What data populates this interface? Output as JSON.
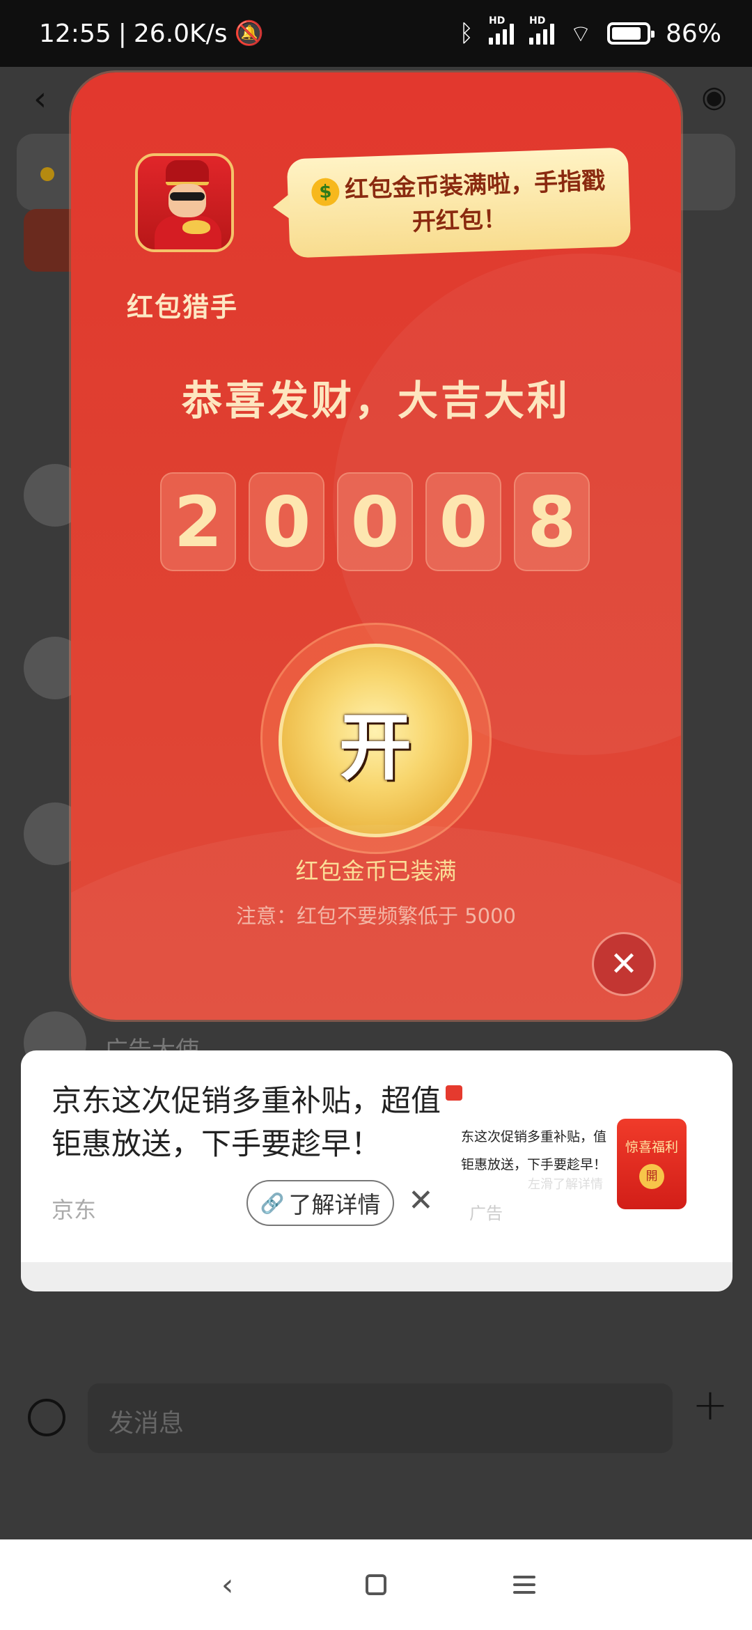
{
  "status": {
    "time": "12:55",
    "speed": "26.0K/s",
    "battery": "86%",
    "battery_level": 0.86,
    "icons": [
      "mute-bell-icon",
      "bluetooth-icon",
      "signal-icon",
      "wifi-icon",
      "battery-icon"
    ]
  },
  "background": {
    "partial_name": "广告大使",
    "input_placeholder": "发消息"
  },
  "modal": {
    "app_name": "红包猎手",
    "bubble_text": "红包金币装满啦，手指戳开红包！",
    "title": "恭喜发财，大吉大利",
    "digits": [
      "2",
      "0",
      "0",
      "0",
      "8"
    ],
    "open_label": "开",
    "coins_full_text": "红包金币已装满",
    "note_text": "注意：红包不要频繁低于 5000",
    "colors": {
      "background": "#e2382e",
      "gold": "#f8d66e",
      "text": "#fde6c0"
    }
  },
  "ad": {
    "title": "京东这次促销多重补贴，超值钜惠放送，下手要趁早！",
    "source": "京东",
    "detail_button": "了解详情",
    "ad_label": "广告",
    "image": {
      "text": "东这次促销多重补贴，值钜惠放送，下手要趁早！",
      "redpacket_label": "惊喜福利",
      "coin_label": "開",
      "swipe_text": "左滑了解详情"
    }
  }
}
